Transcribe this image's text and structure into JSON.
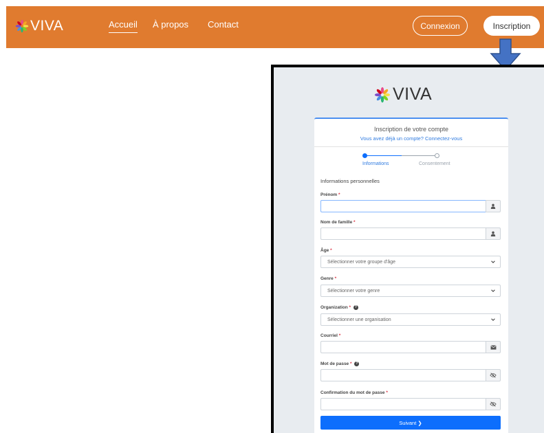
{
  "app": {
    "name": "VIVA"
  },
  "nav": {
    "links": [
      {
        "label": "Accueil",
        "active": true
      },
      {
        "label": "À propos",
        "active": false
      },
      {
        "label": "Contact",
        "active": false
      }
    ],
    "login_label": "Connexion",
    "signup_label": "Inscription"
  },
  "colors": {
    "brand_orange": "#e07b2f",
    "primary_blue": "#0d6efd",
    "arrow_blue": "#4472c4"
  },
  "form": {
    "title": "Inscription de votre compte",
    "subtitle": "Vous avez déjà un compte? Connectez-vous",
    "steps": [
      {
        "label": "Informations",
        "active": true
      },
      {
        "label": "Consentement",
        "active": false
      }
    ],
    "section_title": "Informations personnelles",
    "fields": {
      "first_name": {
        "label": "Prénom",
        "required_mark": "*",
        "icon": "user-icon"
      },
      "last_name": {
        "label": "Nom de famille",
        "required_mark": "*",
        "icon": "user-icon"
      },
      "age": {
        "label": "Âge",
        "required_mark": "*",
        "placeholder": "Sélectionner votre groupe d'âge"
      },
      "gender": {
        "label": "Genre",
        "required_mark": "*",
        "placeholder": "Sélectionner votre genre"
      },
      "organization": {
        "label": "Organization",
        "required_mark": "*",
        "help": "?",
        "placeholder": "Sélectionner une organisation"
      },
      "email": {
        "label": "Courriel",
        "required_mark": "*",
        "icon": "envelope-icon"
      },
      "password": {
        "label": "Mot de passe",
        "required_mark": "*",
        "help": "?",
        "icon": "eye-slash-icon"
      },
      "password_confirm": {
        "label": "Confirmation du mot de passe",
        "required_mark": "*",
        "icon": "eye-slash-icon"
      }
    },
    "next_label": "Suivant ❯"
  }
}
